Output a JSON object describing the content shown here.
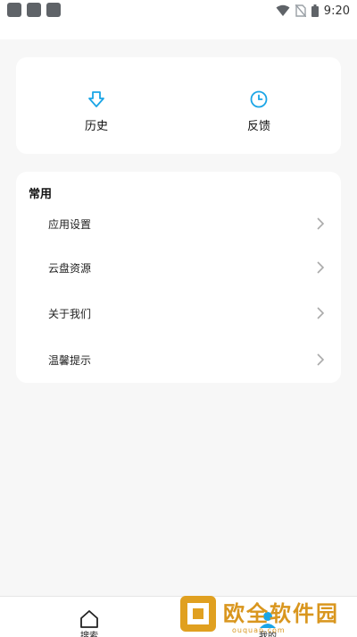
{
  "status_bar": {
    "time": "9:20"
  },
  "quick_actions": [
    {
      "label": "历史",
      "icon": "history-icon"
    },
    {
      "label": "反馈",
      "icon": "feedback-clock-icon"
    }
  ],
  "common_section": {
    "title": "常用",
    "items": [
      {
        "label": "应用设置"
      },
      {
        "label": "云盘资源"
      },
      {
        "label": "关于我们"
      },
      {
        "label": "温馨提示"
      }
    ]
  },
  "tab_bar": {
    "tabs": [
      {
        "label": "搜索",
        "icon": "home-icon"
      },
      {
        "label": "我的",
        "icon": "profile-icon"
      }
    ]
  },
  "watermark": {
    "text": "欧全软件园",
    "url": "ouquan.com"
  },
  "colors": {
    "accent": "#1aa5e6",
    "watermark": "#d9961e",
    "background": "#f7f7f7"
  }
}
